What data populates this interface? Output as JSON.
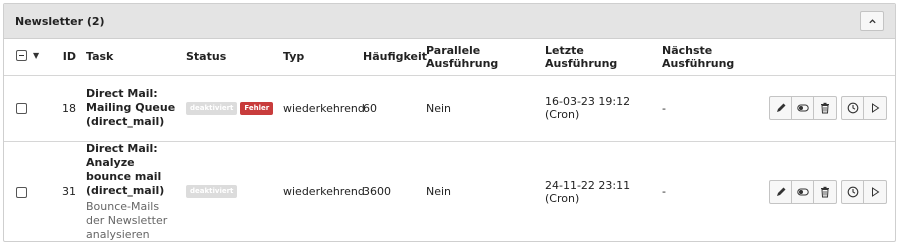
{
  "panel": {
    "title": "Newsletter (2)",
    "collapse_icon": "chevron-up-icon"
  },
  "columns": {
    "id": "ID",
    "task": "Task",
    "status": "Status",
    "typ": "Typ",
    "haeufigkeit": "Häufigkeit",
    "parallel": "Parallele Ausführung",
    "letzte": "Letzte Ausführung",
    "naechste": "Nächste Ausführung"
  },
  "rows": [
    {
      "id": "18",
      "task_name": "Direct Mail: Mailing Queue (direct_mail)",
      "task_desc": "",
      "status_badge": "deaktiviert",
      "error_badge": "Fehler",
      "typ": "wiederkehrend",
      "haeufigkeit": "60",
      "parallel": "Nein",
      "letzte": "16-03-23 19:12 (Cron)",
      "naechste": "-"
    },
    {
      "id": "31",
      "task_name": "Direct Mail: Analyze bounce mail (direct_mail)",
      "task_desc": "Bounce-Mails der Newsletter analysieren",
      "status_badge": "deaktiviert",
      "typ": "wiederkehrend",
      "haeufigkeit": "3600",
      "parallel": "Nein",
      "letzte": "24-11-22 23:11 (Cron)",
      "naechste": "-"
    }
  ],
  "actions": [
    "edit-icon",
    "toggle-icon",
    "trash-icon",
    "clock-icon",
    "play-icon"
  ]
}
